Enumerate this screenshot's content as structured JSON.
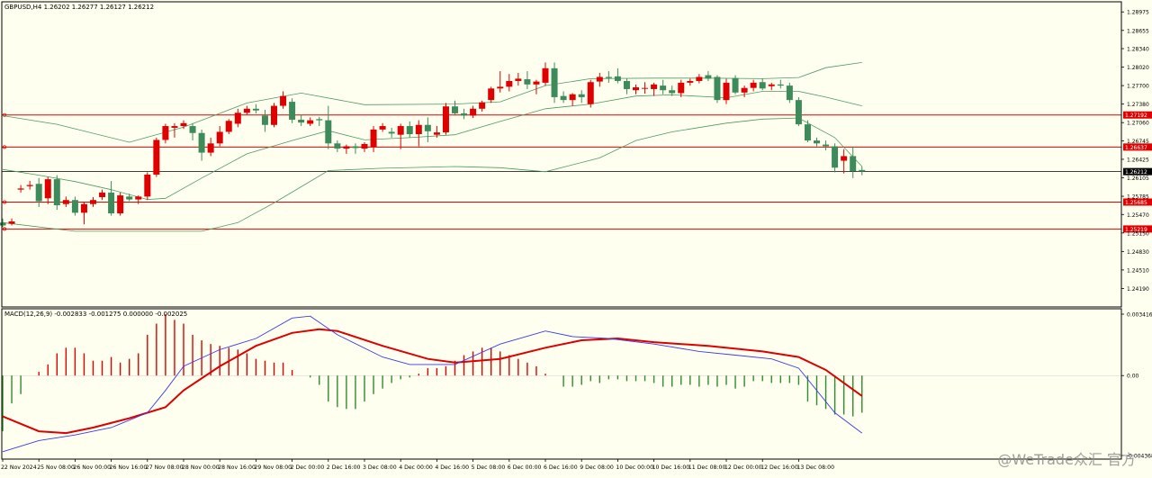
{
  "window": {
    "symbol_header": "GBPUSD,H4  1.26202 1.26277 1.26127 1.26212",
    "indicator_header": "MACD(12,26,9) -0.002833 -0.001275 0.000000 -0.002025",
    "watermark": "@WeTrade众汇 官方"
  },
  "colors": {
    "background": "#fffff0",
    "bull": "#3d8b5a",
    "bear": "#e00000",
    "bollinger": "#4d9a62",
    "hline": "#e00000",
    "price_line": "#000000",
    "macd_line": "#3a3ae8",
    "signal_line": "#dd0000",
    "hist_pos": "#e00000",
    "hist_neg": "#2e8b2e"
  },
  "chart_data": [
    {
      "type": "candlestick",
      "title": "GBPUSD,H4  1.26202 1.26277 1.26127 1.26212",
      "price_axis": {
        "ylim": [
          1.2387,
          1.2915
        ],
        "tick_labels": [
          "1.28975",
          "1.28655",
          "1.28340",
          "1.28020",
          "1.27700",
          "1.27380",
          "1.27060",
          "1.26745",
          "1.26425",
          "1.26105",
          "1.25785",
          "1.25470",
          "1.25150",
          "1.24830",
          "1.24510",
          "1.24190"
        ]
      },
      "time_axis": {
        "tick_labels": [
          "22 Nov 2024",
          "25 Nov 08:00",
          "26 Nov 00:00",
          "26 Nov 16:00",
          "27 Nov 08:00",
          "28 Nov 00:00",
          "28 Nov 16:00",
          "29 Nov 08:00",
          "2 Dec 00:00",
          "2 Dec 16:00",
          "3 Dec 08:00",
          "4 Dec 00:00",
          "4 Dec 16:00",
          "5 Dec 08:00",
          "6 Dec 00:00",
          "6 Dec 16:00",
          "9 Dec 08:00",
          "10 Dec 00:00",
          "10 Dec 16:00",
          "11 Dec 08:00",
          "12 Dec 00:00",
          "12 Dec 16:00",
          "13 Dec 08:00"
        ]
      },
      "candles": [
        [
          1.2533,
          1.254,
          1.2525,
          1.2528
        ],
        [
          1.2531,
          1.254,
          1.2528,
          1.2535
        ],
        [
          1.259,
          1.2598,
          1.2585,
          1.2592
        ],
        [
          1.2596,
          1.2605,
          1.259,
          1.2598
        ],
        [
          1.26,
          1.261,
          1.256,
          1.257
        ],
        [
          1.2575,
          1.2612,
          1.2565,
          1.2608
        ],
        [
          1.2608,
          1.2615,
          1.2555,
          1.2563
        ],
        [
          1.2565,
          1.2578,
          1.256,
          1.2572
        ],
        [
          1.2572,
          1.2578,
          1.2545,
          1.255
        ],
        [
          1.255,
          1.2568,
          1.253,
          1.2565
        ],
        [
          1.2565,
          1.2577,
          1.256,
          1.2572
        ],
        [
          1.2577,
          1.259,
          1.2572,
          1.2585
        ],
        [
          1.2585,
          1.2605,
          1.2545,
          1.2549
        ],
        [
          1.2549,
          1.2585,
          1.2545,
          1.258
        ],
        [
          1.2578,
          1.2583,
          1.257,
          1.2573
        ],
        [
          1.2573,
          1.258,
          1.2565,
          1.2578
        ],
        [
          1.2578,
          1.262,
          1.2572,
          1.2616
        ],
        [
          1.2616,
          1.268,
          1.2612,
          1.2676
        ],
        [
          1.2676,
          1.2704,
          1.267,
          1.27
        ],
        [
          1.2697,
          1.2705,
          1.268,
          1.27
        ],
        [
          1.27,
          1.271,
          1.2695,
          1.2705
        ],
        [
          1.27,
          1.2705,
          1.2675,
          1.2688
        ],
        [
          1.2688,
          1.2694,
          1.264,
          1.2654
        ],
        [
          1.2654,
          1.268,
          1.2648,
          1.267
        ],
        [
          1.267,
          1.27,
          1.2665,
          1.269
        ],
        [
          1.269,
          1.2712,
          1.2686,
          1.2709
        ],
        [
          1.2704,
          1.273,
          1.2698,
          1.2723
        ],
        [
          1.2723,
          1.2735,
          1.272,
          1.273
        ],
        [
          1.273,
          1.2738,
          1.2722,
          1.2727
        ],
        [
          1.2718,
          1.2728,
          1.269,
          1.2702
        ],
        [
          1.2702,
          1.274,
          1.2698,
          1.2735
        ],
        [
          1.2735,
          1.276,
          1.273,
          1.2752
        ],
        [
          1.2742,
          1.2748,
          1.2705,
          1.2711
        ],
        [
          1.2711,
          1.272,
          1.27,
          1.2706
        ],
        [
          1.2704,
          1.2715,
          1.27,
          1.271
        ],
        [
          1.2712,
          1.2716,
          1.27,
          1.271
        ],
        [
          1.271,
          1.2735,
          1.266,
          1.267
        ],
        [
          1.267,
          1.2675,
          1.2655,
          1.2661
        ],
        [
          1.2661,
          1.2668,
          1.2652,
          1.2665
        ],
        [
          1.2665,
          1.267,
          1.2652,
          1.2662
        ],
        [
          1.2661,
          1.2672,
          1.2655,
          1.2669
        ],
        [
          1.2664,
          1.27,
          1.2655,
          1.2694
        ],
        [
          1.2694,
          1.2705,
          1.269,
          1.27
        ],
        [
          1.269,
          1.2697,
          1.268,
          1.2687
        ],
        [
          1.2685,
          1.2704,
          1.266,
          1.27
        ],
        [
          1.27,
          1.2708,
          1.268,
          1.2686
        ],
        [
          1.2686,
          1.271,
          1.2665,
          1.2702
        ],
        [
          1.2702,
          1.2715,
          1.2672,
          1.2691
        ],
        [
          1.2685,
          1.27,
          1.268,
          1.2689
        ],
        [
          1.2689,
          1.274,
          1.2685,
          1.2734
        ],
        [
          1.2734,
          1.2744,
          1.2718,
          1.2722
        ],
        [
          1.2722,
          1.273,
          1.2712,
          1.2718
        ],
        [
          1.2718,
          1.2735,
          1.2714,
          1.273
        ],
        [
          1.273,
          1.2744,
          1.2725,
          1.2741
        ],
        [
          1.2745,
          1.2768,
          1.274,
          1.2765
        ],
        [
          1.2765,
          1.2795,
          1.2758,
          1.2768
        ],
        [
          1.2768,
          1.279,
          1.276,
          1.2778
        ],
        [
          1.2778,
          1.2792,
          1.277,
          1.2782
        ],
        [
          1.2781,
          1.2795,
          1.2764,
          1.2772
        ],
        [
          1.2772,
          1.278,
          1.2755,
          1.2777
        ],
        [
          1.2775,
          1.281,
          1.277,
          1.28
        ],
        [
          1.28,
          1.281,
          1.274,
          1.275
        ],
        [
          1.2752,
          1.276,
          1.274,
          1.2745
        ],
        [
          1.2745,
          1.2757,
          1.2735,
          1.2755
        ],
        [
          1.2755,
          1.2762,
          1.274,
          1.275
        ],
        [
          1.2738,
          1.278,
          1.2732,
          1.2776
        ],
        [
          1.2777,
          1.2792,
          1.2768,
          1.2785
        ],
        [
          1.2785,
          1.2795,
          1.2775,
          1.2783
        ],
        [
          1.2786,
          1.28,
          1.2774,
          1.2778
        ],
        [
          1.2778,
          1.2782,
          1.2755,
          1.2764
        ],
        [
          1.2762,
          1.2772,
          1.2755,
          1.2767
        ],
        [
          1.2765,
          1.2776,
          1.2756,
          1.2766
        ],
        [
          1.2764,
          1.2775,
          1.2752,
          1.2772
        ],
        [
          1.277,
          1.278,
          1.2755,
          1.2762
        ],
        [
          1.2762,
          1.277,
          1.2752,
          1.2757
        ],
        [
          1.2757,
          1.278,
          1.275,
          1.2775
        ],
        [
          1.2775,
          1.2782,
          1.277,
          1.2778
        ],
        [
          1.2778,
          1.279,
          1.2774,
          1.2785
        ],
        [
          1.2788,
          1.2795,
          1.2778,
          1.2782
        ],
        [
          1.2785,
          1.2788,
          1.274,
          1.2745
        ],
        [
          1.2745,
          1.2782,
          1.2738,
          1.2775
        ],
        [
          1.2783,
          1.2788,
          1.2755,
          1.2758
        ],
        [
          1.2758,
          1.277,
          1.275,
          1.2766
        ],
        [
          1.2766,
          1.278,
          1.276,
          1.2775
        ],
        [
          1.2776,
          1.2782,
          1.2762,
          1.2765
        ],
        [
          1.2769,
          1.2775,
          1.2762,
          1.2772
        ],
        [
          1.2772,
          1.278,
          1.2765,
          1.277
        ],
        [
          1.277,
          1.2775,
          1.274,
          1.2745
        ],
        [
          1.2745,
          1.275,
          1.27,
          1.2703
        ],
        [
          1.2703,
          1.271,
          1.2672,
          1.2675
        ],
        [
          1.2675,
          1.268,
          1.2665,
          1.267
        ],
        [
          1.2668,
          1.2675,
          1.2658,
          1.2665
        ],
        [
          1.2665,
          1.267,
          1.262,
          1.2628
        ],
        [
          1.264,
          1.266,
          1.2618,
          1.2648
        ],
        [
          1.2648,
          1.2665,
          1.261,
          1.2622
        ],
        [
          1.2624,
          1.263,
          1.2615,
          1.2621
        ]
      ],
      "bollinger": {
        "upper": [
          [
            0,
            1.2718
          ],
          [
            6,
            1.2703
          ],
          [
            14,
            1.2672
          ],
          [
            20,
            1.2698
          ],
          [
            27,
            1.274
          ],
          [
            33,
            1.2757
          ],
          [
            40,
            1.2737
          ],
          [
            50,
            1.2738
          ],
          [
            55,
            1.2742
          ],
          [
            60,
            1.277
          ],
          [
            65,
            1.2782
          ],
          [
            72,
            1.2783
          ],
          [
            78,
            1.2783
          ],
          [
            84,
            1.2782
          ],
          [
            88,
            1.2784
          ],
          [
            91,
            1.2801
          ],
          [
            95,
            1.281
          ]
        ],
        "middle": [
          [
            0,
            1.2625
          ],
          [
            4,
            1.2615
          ],
          [
            8,
            1.2604
          ],
          [
            12,
            1.259
          ],
          [
            16,
            1.2573
          ],
          [
            18,
            1.2575
          ],
          [
            22,
            1.261
          ],
          [
            27,
            1.2652
          ],
          [
            32,
            1.2675
          ],
          [
            36,
            1.2692
          ],
          [
            40,
            1.2676
          ],
          [
            45,
            1.268
          ],
          [
            50,
            1.2685
          ],
          [
            55,
            1.2708
          ],
          [
            60,
            1.273
          ],
          [
            65,
            1.2738
          ],
          [
            70,
            1.2752
          ],
          [
            74,
            1.2754
          ],
          [
            80,
            1.2749
          ],
          [
            84,
            1.276
          ],
          [
            88,
            1.276
          ],
          [
            91,
            1.275
          ],
          [
            95,
            1.2735
          ]
        ],
        "lower": [
          [
            0,
            1.2533
          ],
          [
            8,
            1.2518
          ],
          [
            16,
            1.2518
          ],
          [
            22,
            1.2518
          ],
          [
            26,
            1.2533
          ],
          [
            30,
            1.2567
          ],
          [
            36,
            1.2623
          ],
          [
            42,
            1.2627
          ],
          [
            50,
            1.263
          ],
          [
            55,
            1.2628
          ],
          [
            60,
            1.2621
          ],
          [
            66,
            1.2645
          ],
          [
            70,
            1.2675
          ],
          [
            74,
            1.269
          ],
          [
            80,
            1.2705
          ],
          [
            84,
            1.2712
          ],
          [
            88,
            1.2714
          ],
          [
            92,
            1.268
          ],
          [
            95,
            1.263
          ]
        ]
      },
      "horizontal_levels": [
        {
          "label": "1.27192",
          "value": 1.27192
        },
        {
          "label": "1.26637",
          "value": 1.26637
        },
        {
          "label": "1.25685",
          "value": 1.25685
        },
        {
          "label": "1.25219",
          "value": 1.25219
        }
      ],
      "current_price": {
        "label": "1.26212",
        "value": 1.26212
      }
    },
    {
      "type": "macd",
      "title": "MACD(12,26,9) -0.002833 -0.001275 0.000000 -0.002025",
      "ylim": [
        -0.0045,
        0.0036
      ],
      "tick_labels": [
        "0.003416",
        "0.00",
        "-0.004368"
      ],
      "histogram": [
        -0.003,
        -0.0015,
        -0.001,
        0.0,
        0.0002,
        0.0006,
        0.0012,
        0.0015,
        0.0015,
        0.0012,
        0.0008,
        0.0008,
        0.001,
        0.0007,
        0.0009,
        0.0012,
        0.0022,
        0.0028,
        0.0033,
        0.003,
        0.0028,
        0.0022,
        0.0019,
        0.0017,
        0.0016,
        0.0015,
        0.0014,
        0.0012,
        0.0009,
        0.0008,
        0.0007,
        0.0007,
        0.0003,
        0.0,
        -0.0001,
        -0.0005,
        -0.0014,
        -0.0017,
        -0.0018,
        -0.0018,
        -0.0014,
        -0.001,
        -0.0007,
        -0.0004,
        -0.0002,
        -0.0001,
        0.0001,
        0.0004,
        0.0004,
        0.0005,
        0.0008,
        0.0011,
        0.0013,
        0.0015,
        0.0015,
        0.0013,
        0.0011,
        0.0009,
        0.0007,
        0.0005,
        0.0001,
        0.0,
        -0.0006,
        -0.0006,
        -0.0005,
        -0.0003,
        -0.0004,
        -0.0002,
        -0.0002,
        -0.0003,
        -0.0003,
        -0.0003,
        -0.0004,
        -0.0006,
        -0.0006,
        -0.0005,
        -0.0005,
        -0.0006,
        -0.0005,
        -0.0006,
        -0.0005,
        -0.0007,
        -0.0006,
        -0.0003,
        -0.0003,
        -0.0004,
        -0.0004,
        -0.0004,
        -0.0005,
        -0.0014,
        -0.0016,
        -0.0018,
        -0.0021,
        -0.0021,
        -0.0022,
        -0.002
      ],
      "macd_line": [
        [
          0,
          -0.0041
        ],
        [
          4,
          -0.0035
        ],
        [
          8,
          -0.0032
        ],
        [
          12,
          -0.0028
        ],
        [
          16,
          -0.002
        ],
        [
          18,
          -0.0008
        ],
        [
          20,
          0.0005
        ],
        [
          24,
          0.0014
        ],
        [
          28,
          0.002
        ],
        [
          32,
          0.0031
        ],
        [
          34,
          0.0032
        ],
        [
          37,
          0.0022
        ],
        [
          42,
          0.001
        ],
        [
          45,
          0.0006
        ],
        [
          50,
          0.0006
        ],
        [
          55,
          0.0017
        ],
        [
          60,
          0.0024
        ],
        [
          63,
          0.0021
        ],
        [
          67,
          0.002
        ],
        [
          72,
          0.0017
        ],
        [
          77,
          0.0013
        ],
        [
          81,
          0.0011
        ],
        [
          85,
          0.0009
        ],
        [
          88,
          0.0004
        ],
        [
          92,
          -0.002
        ],
        [
          95,
          -0.0031
        ]
      ],
      "signal_line": [
        [
          0,
          -0.0022
        ],
        [
          4,
          -0.003
        ],
        [
          7,
          -0.0031
        ],
        [
          10,
          -0.0028
        ],
        [
          14,
          -0.0023
        ],
        [
          18,
          -0.0017
        ],
        [
          20,
          -0.0008
        ],
        [
          24,
          0.0005
        ],
        [
          28,
          0.0016
        ],
        [
          32,
          0.0023
        ],
        [
          35,
          0.0025
        ],
        [
          37,
          0.0024
        ],
        [
          42,
          0.0016
        ],
        [
          47,
          0.0009
        ],
        [
          50,
          0.0007
        ],
        [
          55,
          0.0009
        ],
        [
          60,
          0.0015
        ],
        [
          64,
          0.0019
        ],
        [
          68,
          0.002
        ],
        [
          72,
          0.0018
        ],
        [
          78,
          0.0016
        ],
        [
          84,
          0.0013
        ],
        [
          88,
          0.001
        ],
        [
          91,
          0.0003
        ],
        [
          95,
          -0.0011
        ]
      ]
    }
  ]
}
